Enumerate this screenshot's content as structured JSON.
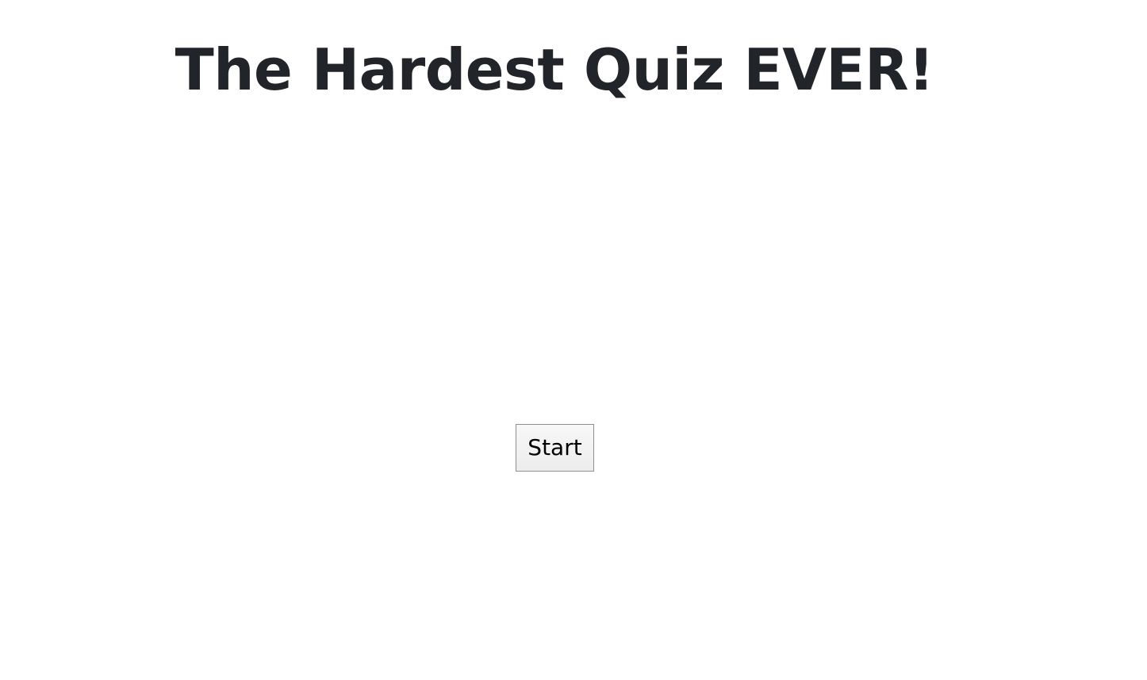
{
  "page": {
    "title": "The Hardest Quiz EVER!"
  },
  "actions": {
    "start_label": "Start"
  },
  "colors": {
    "title_text": "#212529",
    "background": "#ffffff",
    "button_border": "#8f8f8f"
  }
}
